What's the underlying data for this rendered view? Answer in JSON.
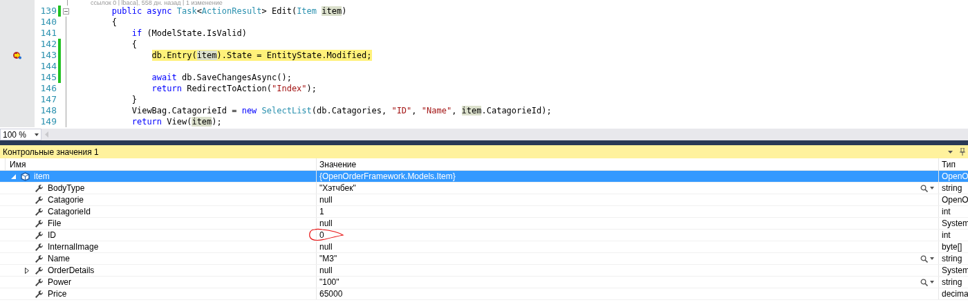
{
  "editor": {
    "lens": "ссылок 0 | lbaca], 558 дн. назад | 1 изменение",
    "lines": [
      {
        "number": "139",
        "changed": true,
        "current": false,
        "breakpoint": false,
        "foldable": true,
        "tokens": [
          {
            "kind": "keyword",
            "text": "        public async "
          },
          {
            "kind": "type",
            "text": "Task"
          },
          {
            "kind": "plain",
            "text": "<"
          },
          {
            "kind": "type",
            "text": "ActionResult"
          },
          {
            "kind": "plain",
            "text": "> Edit("
          },
          {
            "kind": "type",
            "text": "Item "
          },
          {
            "kind": "ref",
            "text": "item"
          },
          {
            "kind": "plain",
            "text": ")"
          }
        ]
      },
      {
        "number": "140",
        "changed": false,
        "current": false,
        "breakpoint": false,
        "foldable": false,
        "tokens": [
          {
            "kind": "plain",
            "text": "        {"
          }
        ]
      },
      {
        "number": "141",
        "changed": false,
        "current": false,
        "breakpoint": false,
        "foldable": false,
        "tokens": [
          {
            "kind": "keyword",
            "text": "            if"
          },
          {
            "kind": "plain",
            "text": " (ModelState.IsValid)"
          }
        ]
      },
      {
        "number": "142",
        "changed": true,
        "current": false,
        "breakpoint": false,
        "foldable": false,
        "tokens": [
          {
            "kind": "plain",
            "text": "            {"
          }
        ]
      },
      {
        "number": "143",
        "changed": true,
        "current": true,
        "breakpoint": true,
        "foldable": false,
        "tokens": [
          {
            "kind": "plain",
            "text": "                db.Entry("
          },
          {
            "kind": "ref",
            "text": "item"
          },
          {
            "kind": "plain",
            "text": ").State = EntityState.Modified;"
          }
        ]
      },
      {
        "number": "144",
        "changed": true,
        "current": false,
        "breakpoint": false,
        "foldable": false
      },
      {
        "number": "145",
        "changed": true,
        "current": false,
        "breakpoint": false,
        "foldable": false,
        "tokens": [
          {
            "kind": "keyword",
            "text": "                await"
          },
          {
            "kind": "plain",
            "text": " db.SaveChangesAsync();"
          }
        ]
      },
      {
        "number": "146",
        "changed": false,
        "current": false,
        "breakpoint": false,
        "foldable": false,
        "tokens": [
          {
            "kind": "keyword",
            "text": "                return"
          },
          {
            "kind": "plain",
            "text": " RedirectToAction("
          },
          {
            "kind": "string",
            "text": "\"Index\""
          },
          {
            "kind": "plain",
            "text": ");"
          }
        ]
      },
      {
        "number": "147",
        "changed": false,
        "current": false,
        "breakpoint": false,
        "foldable": false,
        "tokens": [
          {
            "kind": "plain",
            "text": "            }"
          }
        ]
      },
      {
        "number": "148",
        "changed": false,
        "current": false,
        "breakpoint": false,
        "foldable": false,
        "tokens": [
          {
            "kind": "plain",
            "text": "            ViewBag.CatagorieId = "
          },
          {
            "kind": "keyword",
            "text": "new "
          },
          {
            "kind": "type",
            "text": "SelectList"
          },
          {
            "kind": "plain",
            "text": "(db.Catagories, "
          },
          {
            "kind": "string",
            "text": "\"ID\""
          },
          {
            "kind": "plain",
            "text": ", "
          },
          {
            "kind": "string",
            "text": "\"Name\""
          },
          {
            "kind": "plain",
            "text": ", "
          },
          {
            "kind": "ref",
            "text": "item"
          },
          {
            "kind": "plain",
            "text": ".CatagorieId);"
          }
        ]
      },
      {
        "number": "149",
        "changed": false,
        "current": false,
        "breakpoint": false,
        "foldable": false,
        "tokens": [
          {
            "kind": "keyword",
            "text": "            return"
          },
          {
            "kind": "plain",
            "text": " View("
          },
          {
            "kind": "ref",
            "text": "item"
          },
          {
            "kind": "plain",
            "text": ");"
          }
        ]
      }
    ],
    "zoom": "100 %"
  },
  "watch": {
    "title": "Контрольные значения 1",
    "columns": [
      "Имя",
      "Значение",
      "Тип"
    ],
    "rows": [
      {
        "kind": "object",
        "name": "item",
        "value": "{OpenOrderFramework.Models.Item}",
        "type": "OpenO",
        "selected": true,
        "expandable": true,
        "expanded": true,
        "visualizer": false,
        "annotated": false,
        "children": [
          {
            "kind": "property",
            "name": "BodyType",
            "value": "\"Хэтчбек\"",
            "type": "string",
            "selected": false,
            "expandable": false,
            "expanded": false,
            "visualizer": true,
            "annotated": false
          },
          {
            "kind": "property",
            "name": "Catagorie",
            "value": "null",
            "type": "OpenO",
            "selected": false,
            "expandable": false,
            "expanded": false,
            "visualizer": false,
            "annotated": false
          },
          {
            "kind": "property",
            "name": "CatagorieId",
            "value": "1",
            "type": "int",
            "selected": false,
            "expandable": false,
            "expanded": false,
            "visualizer": false,
            "annotated": false
          },
          {
            "kind": "property",
            "name": "File",
            "value": "null",
            "type": "System",
            "selected": false,
            "expandable": false,
            "expanded": false,
            "visualizer": false,
            "annotated": false
          },
          {
            "kind": "property",
            "name": "ID",
            "value": "0",
            "type": "int",
            "selected": false,
            "expandable": false,
            "expanded": false,
            "visualizer": false,
            "annotated": true
          },
          {
            "kind": "property",
            "name": "InternalImage",
            "value": "null",
            "type": "byte[]",
            "selected": false,
            "expandable": false,
            "expanded": false,
            "visualizer": false,
            "annotated": false
          },
          {
            "kind": "property",
            "name": "Name",
            "value": "\"M3\"",
            "type": "string",
            "selected": false,
            "expandable": false,
            "expanded": false,
            "visualizer": true,
            "annotated": false
          },
          {
            "kind": "property",
            "name": "OrderDetails",
            "value": "null",
            "type": "System",
            "selected": false,
            "expandable": true,
            "expanded": false,
            "visualizer": false,
            "annotated": false
          },
          {
            "kind": "property",
            "name": "Power",
            "value": "\"100\"",
            "type": "string",
            "selected": false,
            "expandable": false,
            "expanded": false,
            "visualizer": true,
            "annotated": false
          },
          {
            "kind": "property",
            "name": "Price",
            "value": "65000",
            "type": "decima",
            "selected": false,
            "expandable": false,
            "expanded": false,
            "visualizer": false,
            "annotated": false
          }
        ]
      }
    ]
  }
}
